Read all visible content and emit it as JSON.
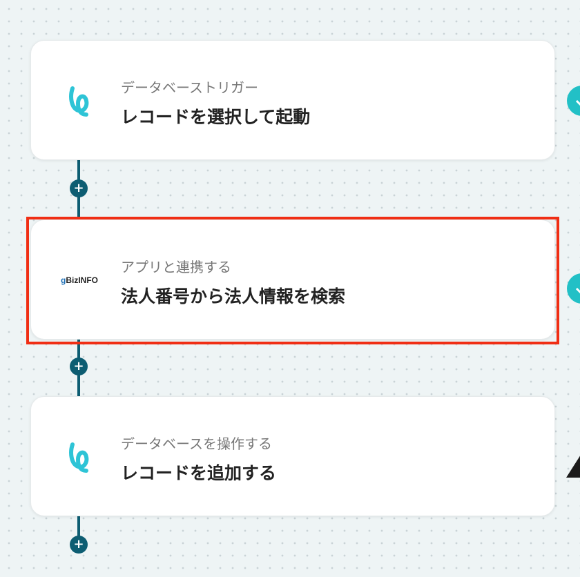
{
  "flow": {
    "steps": [
      {
        "subtitle": "データベーストリガー",
        "title": "レコードを選択して起動",
        "icon": "yoom-database-icon",
        "status": "completed"
      },
      {
        "subtitle": "アプリと連携する",
        "title": "法人番号から法人情報を検索",
        "icon": "gbizinfo-logo",
        "logo_text_g": "g",
        "logo_text_rest": "BizINFO",
        "status": "completed",
        "highlighted": true
      },
      {
        "subtitle": "データベースを操作する",
        "title": "レコードを追加する",
        "icon": "yoom-database-icon",
        "status": "warning"
      }
    ],
    "add_step_label": "+"
  },
  "colors": {
    "background": "#eef4f5",
    "connector": "#0d5d72",
    "highlight_border": "#f02e14",
    "status_complete": "#22c0c6",
    "status_warning": "#1b1b1b",
    "yoom_icon": "#2ec4d6"
  }
}
